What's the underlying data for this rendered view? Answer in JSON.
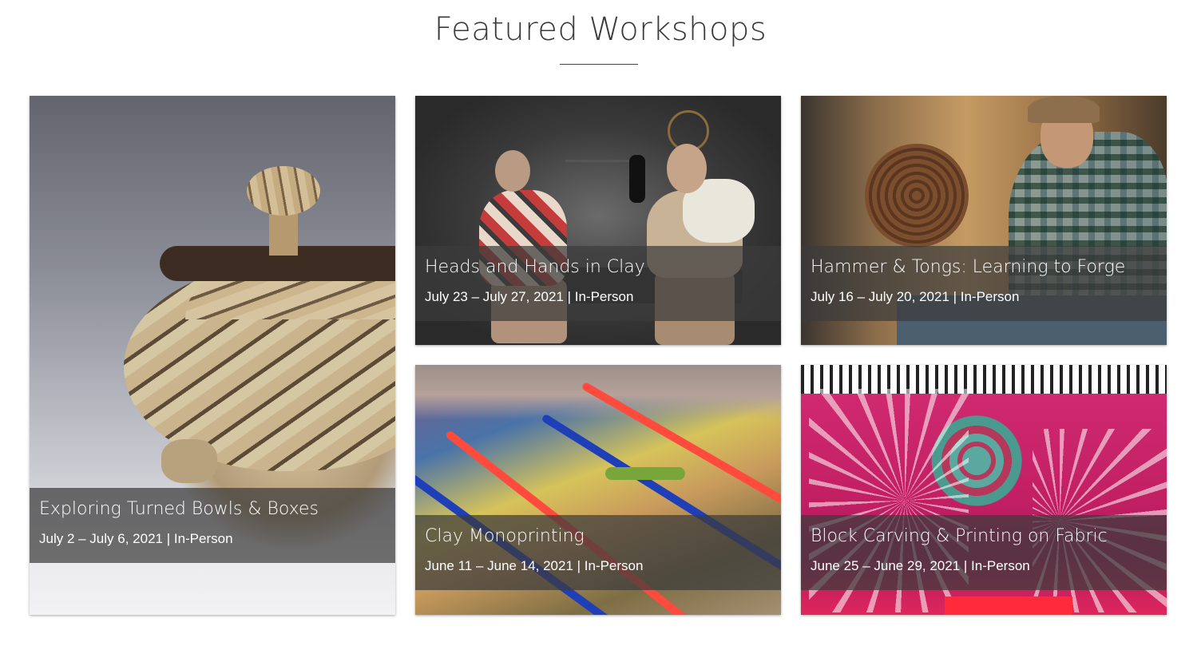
{
  "page": {
    "title": "Featured Workshops"
  },
  "workshops": [
    {
      "title": "Exploring Turned Bowls & Boxes",
      "dates": "July 2 – July 6, 2021 | In-Person",
      "image": "turned-wood-lidded-box-photo"
    },
    {
      "title": "Heads and Hands in Clay",
      "dates": "July 23 – July 27, 2021 | In-Person",
      "image": "clay-figures-sculpture-photo"
    },
    {
      "title": "Hammer & Tongs: Learning to Forge",
      "dates": "July 16 – July 20, 2021 | In-Person",
      "image": "blacksmith-forge-photo"
    },
    {
      "title": "Clay Monoprinting",
      "dates": "June 11 – June 14, 2021 | In-Person",
      "image": "clay-monoprint-colors-photo"
    },
    {
      "title": "Block Carving & Printing on Fabric",
      "dates": "June 25 – June 29, 2021 | In-Person",
      "image": "block-printed-fabric-photo"
    }
  ]
}
